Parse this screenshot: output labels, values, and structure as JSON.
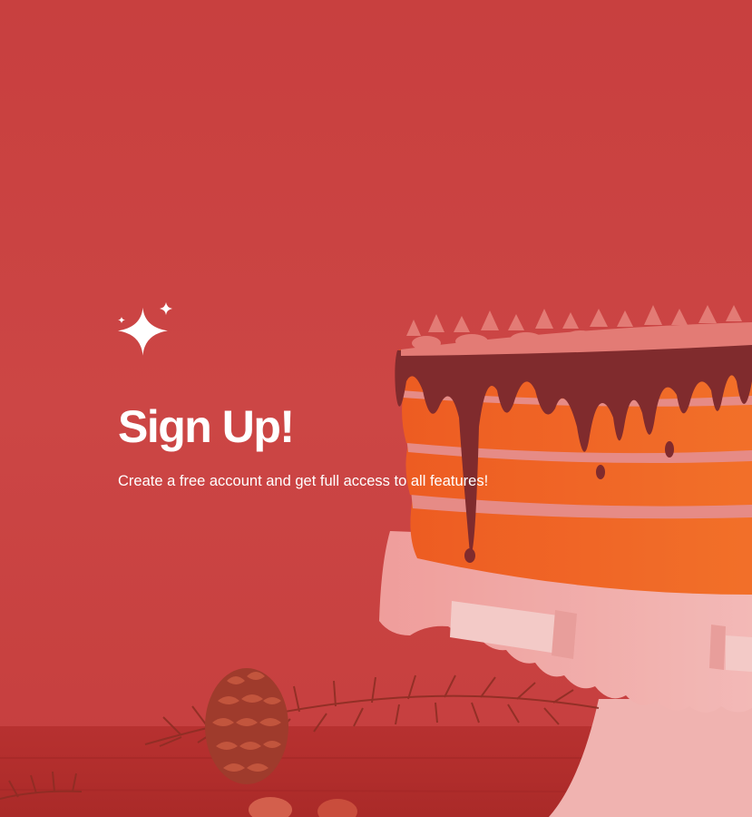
{
  "hero": {
    "title": "Sign Up!",
    "subtitle": "Create a free account and get full access to all features!",
    "icon": "sparkle-icon",
    "image": "cake-photo"
  },
  "colors": {
    "overlay": "#cd4544",
    "text": "#ffffff",
    "cake_orange": "#f36a23",
    "chocolate": "#7a2a2c",
    "stand": "#f0b3b0"
  }
}
